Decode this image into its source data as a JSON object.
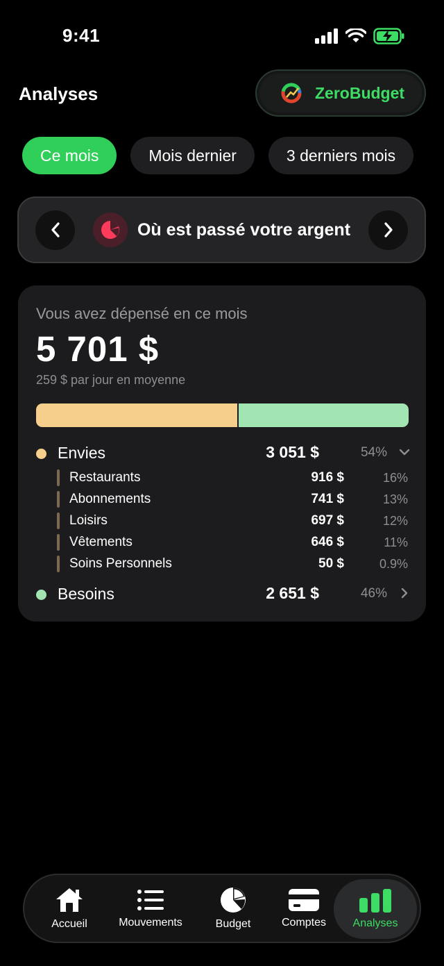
{
  "status_bar": {
    "time": "9:41"
  },
  "header": {
    "title": "Analyses",
    "brand": "ZeroBudget"
  },
  "tabs": [
    {
      "label": "Ce mois",
      "active": true
    },
    {
      "label": "Mois dernier",
      "active": false
    },
    {
      "label": "3 derniers mois",
      "active": false
    }
  ],
  "carousel": {
    "title": "Où est passé votre argent",
    "icon": "pie-chart-icon"
  },
  "summary": {
    "subtitle": "Vous avez dépensé en ce mois",
    "amount": "5 701 $",
    "average": "259 $ par jour en moyenne",
    "bar": [
      {
        "name": "Envies",
        "fraction": 0.54,
        "color": "#f7cf8c"
      },
      {
        "name": "Besoins",
        "fraction": 0.46,
        "color": "#a3e4b3"
      }
    ]
  },
  "groups": [
    {
      "name": "Envies",
      "amount": "3 051 $",
      "pct": "54%",
      "color": "#f7cf8c",
      "expanded": true,
      "items": [
        {
          "name": "Restaurants",
          "amount": "916 $",
          "pct": "16%"
        },
        {
          "name": "Abonnements",
          "amount": "741 $",
          "pct": "13%"
        },
        {
          "name": "Loisirs",
          "amount": "697 $",
          "pct": "12%"
        },
        {
          "name": "Vêtements",
          "amount": "646 $",
          "pct": "11%"
        },
        {
          "name": "Soins Personnels",
          "amount": "50 $",
          "pct": "0.9%"
        }
      ]
    },
    {
      "name": "Besoins",
      "amount": "2 651 $",
      "pct": "46%",
      "color": "#a3e4b3",
      "expanded": false,
      "items": []
    }
  ],
  "nav": [
    {
      "label": "Accueil",
      "icon": "home-icon",
      "active": false
    },
    {
      "label": "Mouvements",
      "icon": "list-icon",
      "active": false
    },
    {
      "label": "Budget",
      "icon": "pie-chart-icon",
      "active": false
    },
    {
      "label": "Comptes",
      "icon": "card-icon",
      "active": false
    },
    {
      "label": "Analyses",
      "icon": "bar-chart-icon",
      "active": true
    }
  ],
  "colors": {
    "accent": "#2fcf59",
    "accent_text": "#3ddc64",
    "background": "#000000",
    "card": "#1c1c1e"
  }
}
